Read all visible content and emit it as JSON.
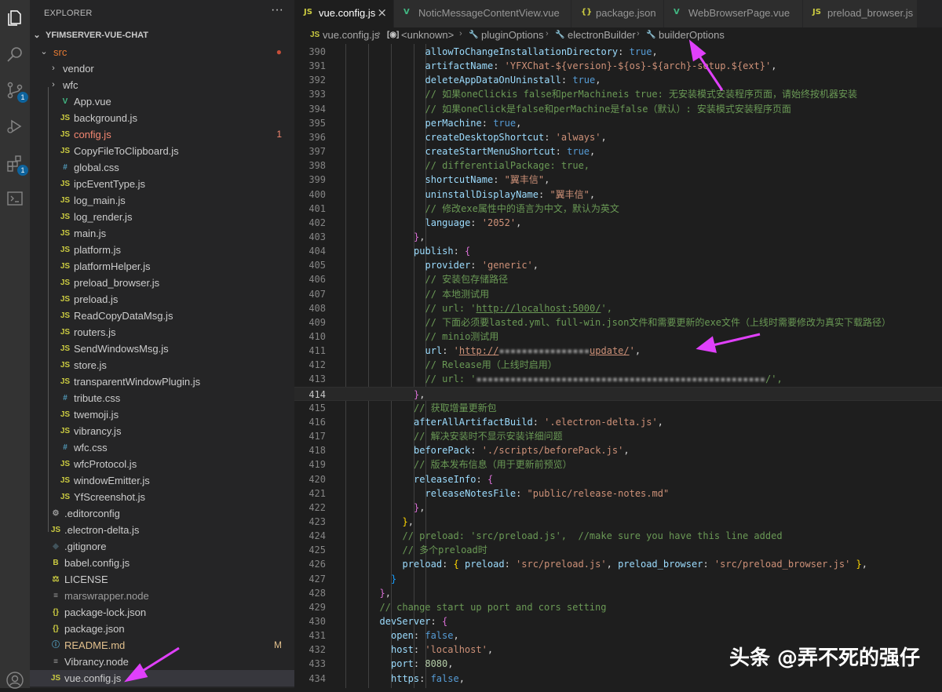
{
  "explorer": {
    "title": "EXPLORER",
    "more": "···",
    "project": "YFIMSERVER-VUE-CHAT",
    "items": [
      {
        "name": "src",
        "type": "folder",
        "open": true,
        "depth": 1,
        "color": "#e37933",
        "badge": "●",
        "badge_color": "#c74e39"
      },
      {
        "name": "vendor",
        "type": "folder",
        "open": false,
        "depth": 2
      },
      {
        "name": "wfc",
        "type": "folder",
        "open": false,
        "depth": 2
      },
      {
        "name": "App.vue",
        "type": "vue",
        "depth": 2
      },
      {
        "name": "background.js",
        "type": "js",
        "depth": 2
      },
      {
        "name": "config.js",
        "type": "js",
        "depth": 2,
        "color": "#f48771",
        "badge": "1",
        "badge_color": "#f48771"
      },
      {
        "name": "CopyFileToClipboard.js",
        "type": "js",
        "depth": 2
      },
      {
        "name": "global.css",
        "type": "css",
        "depth": 2
      },
      {
        "name": "ipcEventType.js",
        "type": "js",
        "depth": 2
      },
      {
        "name": "log_main.js",
        "type": "js",
        "depth": 2
      },
      {
        "name": "log_render.js",
        "type": "js",
        "depth": 2
      },
      {
        "name": "main.js",
        "type": "js",
        "depth": 2
      },
      {
        "name": "platform.js",
        "type": "js",
        "depth": 2
      },
      {
        "name": "platformHelper.js",
        "type": "js",
        "depth": 2
      },
      {
        "name": "preload_browser.js",
        "type": "js",
        "depth": 2
      },
      {
        "name": "preload.js",
        "type": "js",
        "depth": 2
      },
      {
        "name": "ReadCopyDataMsg.js",
        "type": "js",
        "depth": 2
      },
      {
        "name": "routers.js",
        "type": "js",
        "depth": 2
      },
      {
        "name": "SendWindowsMsg.js",
        "type": "js",
        "depth": 2
      },
      {
        "name": "store.js",
        "type": "js",
        "depth": 2
      },
      {
        "name": "transparentWindowPlugin.js",
        "type": "js",
        "depth": 2
      },
      {
        "name": "tribute.css",
        "type": "css",
        "depth": 2
      },
      {
        "name": "twemoji.js",
        "type": "js",
        "depth": 2
      },
      {
        "name": "vibrancy.js",
        "type": "js",
        "depth": 2
      },
      {
        "name": "wfc.css",
        "type": "css",
        "depth": 2
      },
      {
        "name": "wfcProtocol.js",
        "type": "js",
        "depth": 2
      },
      {
        "name": "windowEmitter.js",
        "type": "js",
        "depth": 2
      },
      {
        "name": "YfScreenshot.js",
        "type": "js",
        "depth": 2
      },
      {
        "name": ".editorconfig",
        "type": "gear",
        "depth": 1
      },
      {
        "name": ".electron-delta.js",
        "type": "js",
        "depth": 1
      },
      {
        "name": ".gitignore",
        "type": "git",
        "depth": 1
      },
      {
        "name": "babel.config.js",
        "type": "babel",
        "depth": 1
      },
      {
        "name": "LICENSE",
        "type": "license",
        "depth": 1
      },
      {
        "name": "marswrapper.node",
        "type": "plain",
        "depth": 1,
        "color": "#9d9d9d"
      },
      {
        "name": "package-lock.json",
        "type": "json",
        "depth": 1
      },
      {
        "name": "package.json",
        "type": "json",
        "depth": 1
      },
      {
        "name": "README.md",
        "type": "md",
        "depth": 1,
        "color": "#e2c08d",
        "badge": "M",
        "badge_color": "#e2c08d"
      },
      {
        "name": "Vibrancy.node",
        "type": "plain",
        "depth": 1
      },
      {
        "name": "vue.config.js",
        "type": "js",
        "depth": 1,
        "selected": true
      }
    ]
  },
  "activity_icons": [
    "files-icon",
    "search-icon",
    "source-control-icon",
    "run-debug-icon",
    "extensions-icon",
    "terminal-icon",
    "account-icon"
  ],
  "activity_badges": {
    "source_control": "1",
    "extensions": "1"
  },
  "tabs": [
    {
      "label": "vue.config.js",
      "icon": "JS",
      "icon_color": "#cbcb41",
      "active": true,
      "close": "×"
    },
    {
      "label": "NoticMessageContentView.vue",
      "icon": "V",
      "icon_color": "#41b883"
    },
    {
      "label": "package.json",
      "icon": "{}",
      "icon_color": "#cbcb41"
    },
    {
      "label": "WebBrowserPage.vue",
      "icon": "V",
      "icon_color": "#41b883"
    },
    {
      "label": "preload_browser.js",
      "icon": "JS",
      "icon_color": "#cbcb41"
    }
  ],
  "breadcrumbs": [
    {
      "label": "vue.config.js",
      "icon": "JS"
    },
    {
      "label": "<unknown>",
      "icon": "[◉]"
    },
    {
      "label": "pluginOptions",
      "icon": "🔧"
    },
    {
      "label": "electronBuilder",
      "icon": "🔧"
    },
    {
      "label": "builderOptions",
      "icon": "🔧"
    }
  ],
  "code": {
    "current_line": 414,
    "lines": [
      {
        "n": 390,
        "i": 14,
        "t": [
          [
            "k",
            "allowToChangeInstallationDirectory"
          ],
          [
            "p",
            ": "
          ],
          [
            "b",
            "true"
          ],
          [
            "p",
            ","
          ]
        ]
      },
      {
        "n": 391,
        "i": 14,
        "t": [
          [
            "k",
            "artifactName"
          ],
          [
            "p",
            ": "
          ],
          [
            "s",
            "'YFXChat-${version}-${os}-${arch}-setup.${ext}'"
          ],
          [
            "p",
            ","
          ]
        ]
      },
      {
        "n": 392,
        "i": 14,
        "t": [
          [
            "k",
            "deleteAppDataOnUninstall"
          ],
          [
            "p",
            ": "
          ],
          [
            "b",
            "true"
          ],
          [
            "p",
            ","
          ]
        ]
      },
      {
        "n": 393,
        "i": 14,
        "t": [
          [
            "c",
            "// 如果oneClickis false和perMachineis true: 无安装模式安装程序页面，请始终按机器安装"
          ]
        ]
      },
      {
        "n": 394,
        "i": 14,
        "t": [
          [
            "c",
            "// 如果oneClick是false和perMachine是false（默认）: 安装模式安装程序页面"
          ]
        ]
      },
      {
        "n": 395,
        "i": 14,
        "t": [
          [
            "k",
            "perMachine"
          ],
          [
            "p",
            ": "
          ],
          [
            "b",
            "true"
          ],
          [
            "p",
            ","
          ]
        ]
      },
      {
        "n": 396,
        "i": 14,
        "t": [
          [
            "k",
            "createDesktopShortcut"
          ],
          [
            "p",
            ": "
          ],
          [
            "s",
            "'always'"
          ],
          [
            "p",
            ","
          ]
        ]
      },
      {
        "n": 397,
        "i": 14,
        "t": [
          [
            "k",
            "createStartMenuShortcut"
          ],
          [
            "p",
            ": "
          ],
          [
            "b",
            "true"
          ],
          [
            "p",
            ","
          ]
        ]
      },
      {
        "n": 398,
        "i": 14,
        "t": [
          [
            "c",
            "// differentialPackage: true,"
          ]
        ]
      },
      {
        "n": 399,
        "i": 14,
        "t": [
          [
            "k",
            "shortcutName"
          ],
          [
            "p",
            ": "
          ],
          [
            "s",
            "\"翼丰信\""
          ],
          [
            "p",
            ","
          ]
        ]
      },
      {
        "n": 400,
        "i": 14,
        "t": [
          [
            "k",
            "uninstallDisplayName"
          ],
          [
            "p",
            ": "
          ],
          [
            "s",
            "\"翼丰信\""
          ],
          [
            "p",
            ","
          ]
        ]
      },
      {
        "n": 401,
        "i": 14,
        "t": [
          [
            "c",
            "// 修改exe属性中的语言为中文，默认为英文"
          ]
        ]
      },
      {
        "n": 402,
        "i": 14,
        "t": [
          [
            "k",
            "language"
          ],
          [
            "p",
            ": "
          ],
          [
            "s",
            "'2052'"
          ],
          [
            "p",
            ","
          ]
        ]
      },
      {
        "n": 403,
        "i": 12,
        "t": [
          [
            "br2",
            "}"
          ],
          [
            "p",
            ","
          ]
        ]
      },
      {
        "n": 404,
        "i": 12,
        "t": [
          [
            "k",
            "publish"
          ],
          [
            "p",
            ": "
          ],
          [
            "br2",
            "{"
          ]
        ]
      },
      {
        "n": 405,
        "i": 14,
        "t": [
          [
            "k",
            "provider"
          ],
          [
            "p",
            ": "
          ],
          [
            "s",
            "'generic'"
          ],
          [
            "p",
            ","
          ]
        ]
      },
      {
        "n": 406,
        "i": 14,
        "t": [
          [
            "c",
            "// 安装包存储路径"
          ]
        ]
      },
      {
        "n": 407,
        "i": 14,
        "t": [
          [
            "c",
            "// 本地测试用"
          ]
        ]
      },
      {
        "n": 408,
        "i": 14,
        "t": [
          [
            "c",
            "// url: '"
          ],
          [
            "cu",
            "http://localhost:5000/"
          ],
          [
            "c",
            "',"
          ]
        ]
      },
      {
        "n": 409,
        "i": 14,
        "t": [
          [
            "c",
            "// 下面必须要lasted.yml、full-win.json文件和需要更新的exe文件（上线时需要修改为真实下载路径）"
          ]
        ]
      },
      {
        "n": 410,
        "i": 14,
        "t": [
          [
            "c",
            "// minio测试用"
          ]
        ]
      },
      {
        "n": 411,
        "i": 14,
        "t": [
          [
            "k",
            "url"
          ],
          [
            "p",
            ": "
          ],
          [
            "s",
            "'"
          ],
          [
            "su",
            "http://"
          ],
          [
            "blur",
            "▪▪▪▪▪▪▪▪▪▪▪▪▪▪▪▪"
          ],
          [
            "su",
            "update/"
          ],
          [
            "s",
            "'"
          ],
          [
            "p",
            ","
          ]
        ]
      },
      {
        "n": 412,
        "i": 14,
        "t": [
          [
            "c",
            "// Release用（上线时启用）"
          ]
        ]
      },
      {
        "n": 413,
        "i": 14,
        "t": [
          [
            "c",
            "// url: '"
          ],
          [
            "blur",
            "▪▪▪▪▪▪▪▪▪▪▪▪▪▪▪▪▪▪▪▪▪▪▪▪▪▪▪▪▪▪▪▪▪▪▪▪▪▪▪▪▪▪▪▪▪▪▪▪▪▪▪"
          ],
          [
            "c",
            "/',"
          ]
        ]
      },
      {
        "n": 414,
        "i": 12,
        "t": [
          [
            "br2",
            "}"
          ],
          [
            "p",
            ","
          ]
        ]
      },
      {
        "n": 415,
        "i": 12,
        "t": [
          [
            "c",
            "// 获取增量更新包"
          ]
        ]
      },
      {
        "n": 416,
        "i": 12,
        "t": [
          [
            "k",
            "afterAllArtifactBuild"
          ],
          [
            "p",
            ": "
          ],
          [
            "s",
            "'.electron-delta.js'"
          ],
          [
            "p",
            ","
          ]
        ]
      },
      {
        "n": 417,
        "i": 12,
        "t": [
          [
            "c",
            "// 解决安装时不显示安装详细问题"
          ]
        ]
      },
      {
        "n": 418,
        "i": 12,
        "t": [
          [
            "k",
            "beforePack"
          ],
          [
            "p",
            ": "
          ],
          [
            "s",
            "'./scripts/beforePack.js'"
          ],
          [
            "p",
            ","
          ]
        ]
      },
      {
        "n": 419,
        "i": 12,
        "t": [
          [
            "c",
            "// 版本发布信息（用于更新前预览）"
          ]
        ]
      },
      {
        "n": 420,
        "i": 12,
        "t": [
          [
            "k",
            "releaseInfo"
          ],
          [
            "p",
            ": "
          ],
          [
            "br2",
            "{"
          ]
        ]
      },
      {
        "n": 421,
        "i": 14,
        "t": [
          [
            "k",
            "releaseNotesFile"
          ],
          [
            "p",
            ": "
          ],
          [
            "s",
            "\"public/release-notes.md\""
          ]
        ]
      },
      {
        "n": 422,
        "i": 12,
        "t": [
          [
            "br2",
            "}"
          ],
          [
            "p",
            ","
          ]
        ]
      },
      {
        "n": 423,
        "i": 10,
        "t": [
          [
            "br1",
            "}"
          ],
          [
            "p",
            ","
          ]
        ]
      },
      {
        "n": 424,
        "i": 10,
        "t": [
          [
            "c",
            "// preload: 'src/preload.js',  //make sure you have this line added"
          ]
        ]
      },
      {
        "n": 425,
        "i": 10,
        "t": [
          [
            "c",
            "// 多个preload时"
          ]
        ]
      },
      {
        "n": 426,
        "i": 10,
        "t": [
          [
            "k",
            "preload"
          ],
          [
            "p",
            ": "
          ],
          [
            "br1",
            "{"
          ],
          [
            "p",
            " "
          ],
          [
            "k",
            "preload"
          ],
          [
            "p",
            ": "
          ],
          [
            "s",
            "'src/preload.js'"
          ],
          [
            "p",
            ", "
          ],
          [
            "k",
            "preload_browser"
          ],
          [
            "p",
            ": "
          ],
          [
            "s",
            "'src/preload_browser.js'"
          ],
          [
            "p",
            " "
          ],
          [
            "br1",
            "}"
          ],
          [
            "p",
            ","
          ]
        ]
      },
      {
        "n": 427,
        "i": 8,
        "t": [
          [
            "br3",
            "}"
          ]
        ]
      },
      {
        "n": 428,
        "i": 6,
        "t": [
          [
            "br2",
            "}"
          ],
          [
            "p",
            ","
          ]
        ]
      },
      {
        "n": 429,
        "i": 6,
        "t": [
          [
            "c",
            "// change start up port and cors setting"
          ]
        ]
      },
      {
        "n": 430,
        "i": 6,
        "t": [
          [
            "k",
            "devServer"
          ],
          [
            "p",
            ": "
          ],
          [
            "br2",
            "{"
          ]
        ]
      },
      {
        "n": 431,
        "i": 8,
        "t": [
          [
            "k",
            "open"
          ],
          [
            "p",
            ": "
          ],
          [
            "b",
            "false"
          ],
          [
            "p",
            ","
          ]
        ]
      },
      {
        "n": 432,
        "i": 8,
        "t": [
          [
            "k",
            "host"
          ],
          [
            "p",
            ": "
          ],
          [
            "s",
            "'localhost'"
          ],
          [
            "p",
            ","
          ]
        ]
      },
      {
        "n": 433,
        "i": 8,
        "t": [
          [
            "k",
            "port"
          ],
          [
            "p",
            ": "
          ],
          [
            "n",
            "8080"
          ],
          [
            "p",
            ","
          ]
        ]
      },
      {
        "n": 434,
        "i": 8,
        "t": [
          [
            "k",
            "https"
          ],
          [
            "p",
            ": "
          ],
          [
            "b",
            "false"
          ],
          [
            "p",
            ","
          ]
        ]
      }
    ]
  },
  "watermark": "头条 @弄不死的强仔",
  "colors": {
    "annotation_arrow": "#e040fb",
    "js_icon": "#cbcb41",
    "vue_icon": "#41b883",
    "css_icon": "#519aba"
  }
}
